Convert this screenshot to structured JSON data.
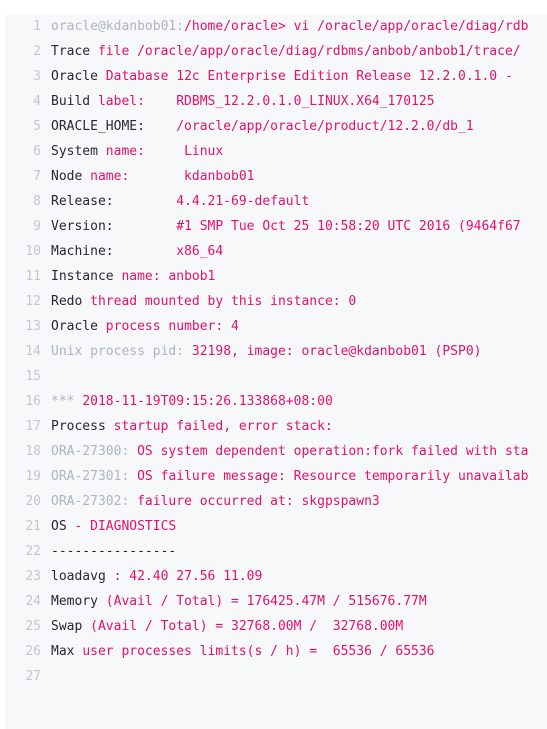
{
  "code_block": {
    "language": "oracle-trace-log",
    "background_color": "#f6f8fa",
    "gutter_color": "#c4c8cc",
    "colors": {
      "keyword_dark": "#24292e",
      "string_pink": "#e3116c",
      "comment_gray": "#adb5bd"
    },
    "line_numbers": [
      "1",
      "2",
      "3",
      "4",
      "5",
      "6",
      "7",
      "8",
      "9",
      "10",
      "11",
      "12",
      "13",
      "14",
      "15",
      "16",
      "17",
      "18",
      "19",
      "20",
      "21",
      "22",
      "23",
      "24",
      "25",
      "26",
      "27"
    ],
    "lines": [
      {
        "number": "1",
        "tokens": [
          {
            "t": "oracle@kdanbob01:",
            "c": "gray"
          },
          {
            "t": "/home/oracle> vi /oracle/app/oracle/diag/rdb",
            "c": "pink"
          }
        ]
      },
      {
        "number": "2",
        "tokens": [
          {
            "t": "Trace ",
            "c": "dark"
          },
          {
            "t": "file /oracle/app/oracle/diag/rdbms/anbob/anbob1/trace/",
            "c": "pink"
          }
        ]
      },
      {
        "number": "3",
        "tokens": [
          {
            "t": "Oracle ",
            "c": "dark"
          },
          {
            "t": "Database 12c Enterprise Edition Release 12.2.0.1.0 - ",
            "c": "pink"
          }
        ]
      },
      {
        "number": "4",
        "tokens": [
          {
            "t": "Build ",
            "c": "dark"
          },
          {
            "t": "label:    RDBMS_12.2.0.1.0_LINUX.X64_170125",
            "c": "pink"
          }
        ]
      },
      {
        "number": "5",
        "tokens": [
          {
            "t": "ORACLE_HOME:",
            "c": "dark"
          },
          {
            "t": "    /oracle/app/oracle/product/12.2.0/db_1",
            "c": "pink"
          }
        ]
      },
      {
        "number": "6",
        "tokens": [
          {
            "t": "System ",
            "c": "dark"
          },
          {
            "t": "name:     Linux",
            "c": "pink"
          }
        ]
      },
      {
        "number": "7",
        "tokens": [
          {
            "t": "Node ",
            "c": "dark"
          },
          {
            "t": "name:       kdanbob01",
            "c": "pink"
          }
        ]
      },
      {
        "number": "8",
        "tokens": [
          {
            "t": "Release:",
            "c": "dark"
          },
          {
            "t": "        4.4.21-69-default",
            "c": "pink"
          }
        ]
      },
      {
        "number": "9",
        "tokens": [
          {
            "t": "Version:",
            "c": "dark"
          },
          {
            "t": "        #1 SMP Tue Oct 25 10:58:20 UTC 2016 (9464f67",
            "c": "pink"
          }
        ]
      },
      {
        "number": "10",
        "tokens": [
          {
            "t": "Machine:",
            "c": "dark"
          },
          {
            "t": "        x86_64",
            "c": "pink"
          }
        ]
      },
      {
        "number": "11",
        "tokens": [
          {
            "t": "Instance ",
            "c": "dark"
          },
          {
            "t": "name: anbob1",
            "c": "pink"
          }
        ]
      },
      {
        "number": "12",
        "tokens": [
          {
            "t": "Redo ",
            "c": "dark"
          },
          {
            "t": "thread mounted by this instance: 0",
            "c": "pink"
          }
        ]
      },
      {
        "number": "13",
        "tokens": [
          {
            "t": "Oracle ",
            "c": "dark"
          },
          {
            "t": "process number: 4",
            "c": "pink"
          }
        ]
      },
      {
        "number": "14",
        "tokens": [
          {
            "t": "Unix process pid:",
            "c": "gray"
          },
          {
            "t": " 32198, image: oracle@kdanbob01 (PSP0)",
            "c": "pink"
          }
        ]
      },
      {
        "number": "15",
        "tokens": [
          {
            "t": "",
            "c": "dark"
          }
        ]
      },
      {
        "number": "16",
        "tokens": [
          {
            "t": "*** ",
            "c": "gray"
          },
          {
            "t": "2018-11-19T09:15:26.133868+08:00",
            "c": "pink"
          }
        ]
      },
      {
        "number": "17",
        "tokens": [
          {
            "t": "Process ",
            "c": "dark"
          },
          {
            "t": "startup failed, error stack:",
            "c": "pink"
          }
        ]
      },
      {
        "number": "18",
        "tokens": [
          {
            "t": "ORA-27300:",
            "c": "gray"
          },
          {
            "t": " OS system dependent operation:fork failed with sta",
            "c": "pink"
          }
        ]
      },
      {
        "number": "19",
        "tokens": [
          {
            "t": "ORA-27301:",
            "c": "gray"
          },
          {
            "t": " OS failure message: Resource temporarily unavailab",
            "c": "pink"
          }
        ]
      },
      {
        "number": "20",
        "tokens": [
          {
            "t": "ORA-27302:",
            "c": "gray"
          },
          {
            "t": " failure occurred at: skgpspawn3",
            "c": "pink"
          }
        ]
      },
      {
        "number": "21",
        "tokens": [
          {
            "t": "OS ",
            "c": "dark"
          },
          {
            "t": "- DIAGNOSTICS",
            "c": "pink"
          }
        ]
      },
      {
        "number": "22",
        "tokens": [
          {
            "t": "----------------",
            "c": "dark"
          }
        ]
      },
      {
        "number": "23",
        "tokens": [
          {
            "t": "loadavg ",
            "c": "dark"
          },
          {
            "t": ": 42.40 27.56 11.09",
            "c": "pink"
          }
        ]
      },
      {
        "number": "24",
        "tokens": [
          {
            "t": "Memory ",
            "c": "dark"
          },
          {
            "t": "(Avail / Total) = 176425.47M / 515676.77M",
            "c": "pink"
          }
        ]
      },
      {
        "number": "25",
        "tokens": [
          {
            "t": "Swap ",
            "c": "dark"
          },
          {
            "t": "(Avail / Total) = 32768.00M /  32768.00M",
            "c": "pink"
          }
        ]
      },
      {
        "number": "26",
        "tokens": [
          {
            "t": "Max ",
            "c": "dark"
          },
          {
            "t": "user processes limits(s / h) =  65536 / 65536",
            "c": "pink"
          }
        ]
      },
      {
        "number": "27",
        "tokens": [
          {
            "t": "",
            "c": "dark"
          }
        ]
      }
    ]
  }
}
